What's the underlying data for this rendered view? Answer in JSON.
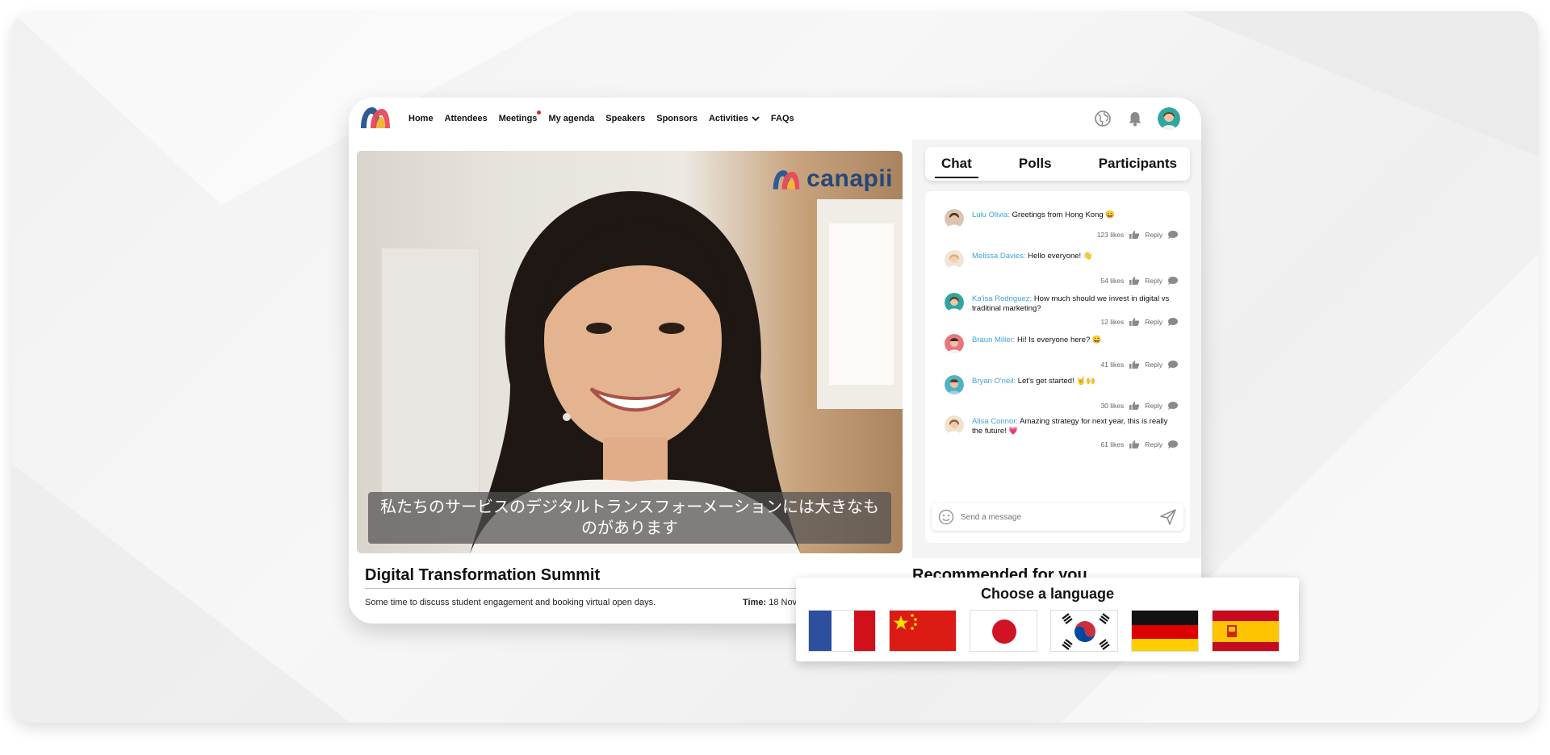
{
  "nav": {
    "items": [
      "Home",
      "Attendees",
      "Meetings",
      "My agenda",
      "Speakers",
      "Sponsors",
      "Activities",
      "FAQs"
    ]
  },
  "video": {
    "brand": "canapii",
    "caption": "私たちのサービスのデジタルトランスフォーメーションには大きなものがあります"
  },
  "event": {
    "title": "Digital Transformation Summit",
    "description": "Some time to discuss student engagement and booking virtual open days.",
    "time_label": "Time:",
    "time_value": "18 Nov"
  },
  "recommended": "Recommended for you",
  "tabs": [
    "Chat",
    "Polls",
    "Participants"
  ],
  "chat": {
    "messages": [
      {
        "name": "Lulu Olivia:",
        "text": "Greetings from Hong Kong 😀",
        "likes": "123 likes",
        "reply": "Reply"
      },
      {
        "name": "Melissa Davies:",
        "text": "Hello everyone! 👋",
        "likes": "54 likes",
        "reply": "Reply"
      },
      {
        "name": "Ka'isa Rodriguez:",
        "text": "How much should we invest in digital vs traditinal marketing?",
        "likes": "12 likes",
        "reply": "Reply"
      },
      {
        "name": "Braun Miller:",
        "text": "Hi! Is everyone here? 😀",
        "likes": "41 likes",
        "reply": "Reply"
      },
      {
        "name": "Bryan O'neil:",
        "text": "Let's get started! 🤘🙌",
        "likes": "30 likes",
        "reply": "Reply"
      },
      {
        "name": "Alisa Connor:",
        "text": "Amazing strategy for next year, this is really the future! 💗",
        "likes": "61 likes",
        "reply": "Reply"
      }
    ],
    "placeholder": "Send a message"
  },
  "language": {
    "title": "Choose a language",
    "flags": [
      "france-flag",
      "china-flag",
      "japan-flag",
      "south-korea-flag",
      "germany-flag",
      "spain-flag"
    ]
  },
  "colors": {
    "accent_name": "#3aa5d6",
    "notification_dot": "#e0242e",
    "brand_navy": "#24487a"
  }
}
